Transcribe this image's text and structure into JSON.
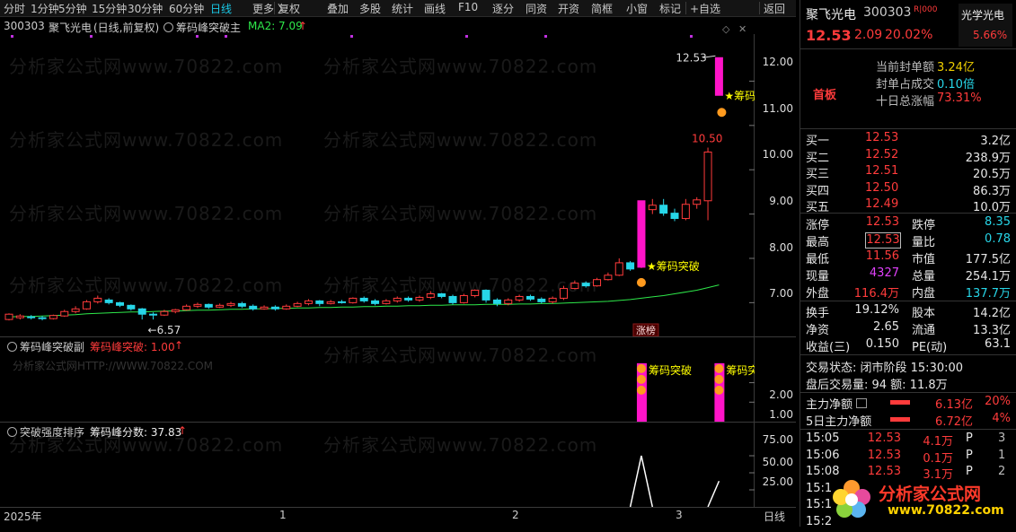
{
  "toolbar": {
    "items": [
      "分时",
      "1分钟",
      "5分钟",
      "15分钟",
      "30分钟",
      "60分钟",
      "日线",
      "更多 〉",
      "复权",
      "叠加",
      "多股",
      "统计",
      "画线",
      "F10",
      "逐分",
      "同资",
      "开资",
      "简框",
      "小窗",
      "标记",
      "+自选",
      "返回"
    ],
    "active": "日线"
  },
  "main_header": {
    "code": "300303",
    "name": "聚飞光电",
    "mode": "(日线,前复权)",
    "indicator": "筹码峰突破主",
    "ma_label": "MA2: 7.09",
    "arrow": "↑"
  },
  "sub1_header": {
    "indicator": "筹码峰突破副",
    "item": "筹码峰突破: 1.00",
    "arrow": "↑"
  },
  "sub2_header": {
    "indicator": "突破强度排序",
    "item": "筹码峰分数: 37.83",
    "arrow": "↑"
  },
  "watermark": {
    "text": "分析家公式网www.70822.com",
    "sub_text": "分析家公式网HTTP://WWW.70822.COM"
  },
  "annotations": {
    "peak_label": "12.53",
    "high_label": "10.50",
    "low_label": "←6.57",
    "signal_text": "★筹码突破",
    "signal_text2": "★筹码突",
    "limit_up_tag": "涨榜",
    "sub_signal": "筹码突破",
    "sub_signal2": "筹码突"
  },
  "main_axis": [
    "12.00",
    "11.00",
    "10.00",
    "9.00",
    "8.00",
    "7.00"
  ],
  "sub1_axis": [
    "2.00",
    "1.00"
  ],
  "sub2_axis": [
    "75.00",
    "50.00",
    "25.00"
  ],
  "time_axis": [
    "2025年",
    "1",
    "2",
    "3"
  ],
  "period_label": "日线",
  "chart_data": {
    "type": "candlestick",
    "price_range": [
      6.4,
      12.9
    ],
    "ma_label": "MA2",
    "candles": [
      [
        6.62,
        6.74,
        6.6,
        6.76
      ],
      [
        6.66,
        6.7,
        6.62,
        6.74
      ],
      [
        6.68,
        6.66,
        6.62,
        6.72
      ],
      [
        6.66,
        6.64,
        6.6,
        6.7
      ],
      [
        6.64,
        6.71,
        6.62,
        6.73
      ],
      [
        6.7,
        6.8,
        6.68,
        6.84
      ],
      [
        6.8,
        6.86,
        6.76,
        6.92
      ],
      [
        6.86,
        7.02,
        6.84,
        7.06
      ],
      [
        7.02,
        7.1,
        6.98,
        7.16
      ],
      [
        7.06,
        7.0,
        6.96,
        7.1
      ],
      [
        7.0,
        6.94,
        6.9,
        7.02
      ],
      [
        6.94,
        6.86,
        6.82,
        6.96
      ],
      [
        6.86,
        6.74,
        6.62,
        6.88
      ],
      [
        6.74,
        6.72,
        6.62,
        6.78
      ],
      [
        6.72,
        6.8,
        6.7,
        6.84
      ],
      [
        6.8,
        6.84,
        6.76,
        6.86
      ],
      [
        6.84,
        6.92,
        6.82,
        6.96
      ],
      [
        6.92,
        6.96,
        6.88,
        7.0
      ],
      [
        6.96,
        6.9,
        6.86,
        6.98
      ],
      [
        6.9,
        6.94,
        6.88,
        6.98
      ],
      [
        6.94,
        6.98,
        6.9,
        7.02
      ],
      [
        6.98,
        6.92,
        6.88,
        7.02
      ],
      [
        6.92,
        6.86,
        6.82,
        6.96
      ],
      [
        6.86,
        6.9,
        6.84,
        6.94
      ],
      [
        6.9,
        6.86,
        6.82,
        6.94
      ],
      [
        6.86,
        6.92,
        6.84,
        6.96
      ],
      [
        6.92,
        6.98,
        6.9,
        7.02
      ],
      [
        6.98,
        7.04,
        6.94,
        7.08
      ],
      [
        7.04,
        6.98,
        6.92,
        7.06
      ],
      [
        6.98,
        7.02,
        6.96,
        7.06
      ],
      [
        7.02,
        7.0,
        6.98,
        7.06
      ],
      [
        7.0,
        7.1,
        6.98,
        7.12
      ],
      [
        7.1,
        7.04,
        7.0,
        7.14
      ],
      [
        7.04,
        6.98,
        6.94,
        7.08
      ],
      [
        6.98,
        7.04,
        6.96,
        7.08
      ],
      [
        7.04,
        7.1,
        7.0,
        7.14
      ],
      [
        7.1,
        7.06,
        7.02,
        7.14
      ],
      [
        7.06,
        7.12,
        7.02,
        7.16
      ],
      [
        7.12,
        7.2,
        7.08,
        7.26
      ],
      [
        7.2,
        7.14,
        7.1,
        7.22
      ],
      [
        7.14,
        7.0,
        6.96,
        7.18
      ],
      [
        7.0,
        7.16,
        6.98,
        7.2
      ],
      [
        7.16,
        7.28,
        7.12,
        7.3
      ],
      [
        7.28,
        7.06,
        7.0,
        7.3
      ],
      [
        7.06,
        6.98,
        6.92,
        7.1
      ],
      [
        6.98,
        7.06,
        6.94,
        7.1
      ],
      [
        7.06,
        7.14,
        7.02,
        7.18
      ],
      [
        7.14,
        7.08,
        7.04,
        7.18
      ],
      [
        7.08,
        7.02,
        6.98,
        7.12
      ],
      [
        7.02,
        7.1,
        6.98,
        7.14
      ],
      [
        7.1,
        7.32,
        7.06,
        7.38
      ],
      [
        7.32,
        7.44,
        7.3,
        7.5
      ],
      [
        7.44,
        7.38,
        7.34,
        7.48
      ],
      [
        7.38,
        7.52,
        7.36,
        7.56
      ],
      [
        7.52,
        7.62,
        7.5,
        7.68
      ],
      [
        7.62,
        7.9,
        7.6,
        8.0
      ],
      [
        7.9,
        7.76,
        7.72,
        7.94
      ],
      [
        7.8,
        9.3,
        7.78,
        9.3
      ],
      [
        9.1,
        9.2,
        9.0,
        9.34
      ],
      [
        9.2,
        9.02,
        8.96,
        9.34
      ],
      [
        9.02,
        8.9,
        8.84,
        9.12
      ],
      [
        8.9,
        9.22,
        8.86,
        9.34
      ],
      [
        9.22,
        9.32,
        9.12,
        9.38
      ],
      [
        9.3,
        10.4,
        8.86,
        10.5
      ],
      [
        11.68,
        12.53,
        11.68,
        12.53
      ]
    ],
    "ma": [
      6.68,
      6.69,
      6.69,
      6.7,
      6.71,
      6.72,
      6.73,
      6.75,
      6.76,
      6.77,
      6.78,
      6.79,
      6.79,
      6.8,
      6.81,
      6.81,
      6.82,
      6.83,
      6.83,
      6.84,
      6.85,
      6.85,
      6.86,
      6.86,
      6.87,
      6.87,
      6.88,
      6.88,
      6.89,
      6.89,
      6.9,
      6.9,
      6.91,
      6.91,
      6.92,
      6.92,
      6.93,
      6.93,
      6.94,
      6.94,
      6.95,
      6.95,
      6.95,
      6.96,
      6.96,
      6.96,
      6.97,
      6.97,
      6.98,
      6.98,
      6.99,
      7.0,
      7.01,
      7.02,
      7.03,
      7.05,
      7.07,
      7.1,
      7.13,
      7.16,
      7.2,
      7.24,
      7.28,
      7.34,
      7.4
    ],
    "sub1": {
      "range": [
        0,
        3.5
      ],
      "signals": [
        {
          "index": 57,
          "value": 3.0
        },
        {
          "index": 64,
          "value": 3.0
        }
      ]
    },
    "sub2": {
      "range": [
        0,
        100
      ],
      "values": [
        {
          "index": 56,
          "value": 0
        },
        {
          "index": 57,
          "value": 75
        },
        {
          "index": 58,
          "value": 0
        },
        {
          "index": 63,
          "value": 0
        },
        {
          "index": 64,
          "value": 37.83
        }
      ]
    }
  },
  "quote": {
    "name": "聚飞光电",
    "code": "300303",
    "r_tag": "R|000",
    "sector_name": "光学光电",
    "sector_pct": "5.66%",
    "price": "12.53",
    "change": "2.09",
    "pct": "20.02%",
    "limit_tag": "首板",
    "info": [
      {
        "label": "当前封单额",
        "value": "3.24亿",
        "color": "yel"
      },
      {
        "label": "封单占成交",
        "value": "0.10倍",
        "color": "cyan"
      },
      {
        "label": "十日总涨幅",
        "value": "73.31%",
        "color": "red"
      }
    ],
    "book": [
      {
        "label": "买一",
        "price": "12.53",
        "vol": "3.2亿"
      },
      {
        "label": "买二",
        "price": "12.52",
        "vol": "238.9万"
      },
      {
        "label": "买三",
        "price": "12.51",
        "vol": "20.5万"
      },
      {
        "label": "买四",
        "price": "12.50",
        "vol": "86.3万"
      },
      {
        "label": "买五",
        "price": "12.49",
        "vol": "10.0万"
      }
    ],
    "stats": [
      {
        "l1": "涨停",
        "v1": "12.53",
        "c1": "red",
        "l2": "跌停",
        "v2": "8.35",
        "c2": "cyan"
      },
      {
        "l1": "最高",
        "v1": "12.53",
        "c1": "red",
        "l2": "量比",
        "v2": "0.78",
        "c2": "cyan"
      },
      {
        "l1": "最低",
        "v1": "11.56",
        "c1": "red",
        "l2": "市值",
        "v2": "177.5亿",
        "c2": "wht"
      },
      {
        "l1": "现量",
        "v1": "4327",
        "c1": "mag",
        "l2": "总量",
        "v2": "254.1万",
        "c2": "wht"
      },
      {
        "l1": "外盘",
        "v1": "116.4万",
        "c1": "red",
        "l2": "内盘",
        "v2": "137.7万",
        "c2": "cyan"
      }
    ],
    "fin": [
      {
        "l1": "换手",
        "v1": "19.12%",
        "l2": "股本",
        "v2": "14.2亿"
      },
      {
        "l1": "净资",
        "v1": "2.65",
        "l2": "流通",
        "v2": "13.3亿"
      },
      {
        "l1": "收益(三)",
        "v1": "0.150",
        "l2": "PE(动)",
        "v2": "63.1"
      }
    ],
    "trade_status": "交易状态: 闭市阶段 15:30:00",
    "after_trade": "盘后交易量: 94  额: 11.8万",
    "flows": [
      {
        "label": "主力净额",
        "value": "6.13亿",
        "pct": "20%"
      },
      {
        "label": "5日主力净额",
        "value": "6.72亿",
        "pct": "4%"
      }
    ],
    "ticks": [
      {
        "time": "15:05",
        "price": "12.53",
        "vol": "4.1万",
        "flag": "P",
        "n": "3"
      },
      {
        "time": "15:06",
        "price": "12.53",
        "vol": "0.1万",
        "flag": "P",
        "n": "1"
      },
      {
        "time": "15:08",
        "price": "12.53",
        "vol": "3.1万",
        "flag": "P",
        "n": "2"
      },
      {
        "time": "15:1",
        "price": "",
        "vol": "",
        "flag": "",
        "n": ""
      },
      {
        "time": "15:1",
        "price": "",
        "vol": "",
        "flag": "",
        "n": ""
      },
      {
        "time": "15:2",
        "price": "",
        "vol": "",
        "flag": "",
        "n": ""
      }
    ]
  },
  "logo": {
    "text": "分析家公式网",
    "url": "www.70822.com"
  },
  "colors": {
    "up": "#ff3b3b",
    "down": "#27d6e8",
    "ma": "#2ee84a",
    "signal": "#ff14c8",
    "label_yellow": "#ffff00"
  }
}
